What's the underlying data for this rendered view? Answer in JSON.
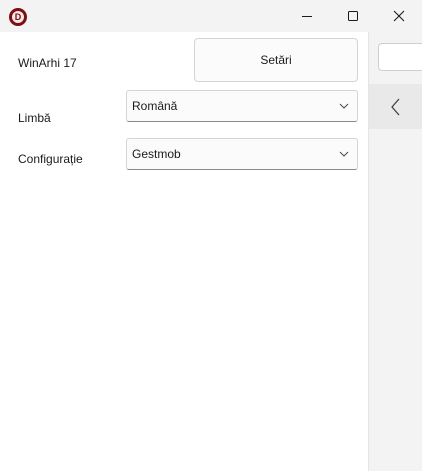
{
  "titlebar": {
    "app_icon_letter": "D",
    "icons": {
      "app": "app-logo-icon",
      "minimize": "minimize-icon",
      "maximize": "maximize-icon",
      "close": "close-icon"
    }
  },
  "main": {
    "app_name": "WinArhi 17",
    "settings_label": "Setări",
    "language": {
      "label": "Limbă",
      "selected": "Română"
    },
    "configuration": {
      "label": "Configurație",
      "selected": "Gestmob"
    }
  },
  "side_pane": {
    "input_value": "",
    "back_icon": "chevron-left-icon"
  },
  "colors": {
    "titlebar_bg": "#f3f3f3",
    "side_pane_bg": "#f3f3f3",
    "brand": "#7a0f14"
  }
}
